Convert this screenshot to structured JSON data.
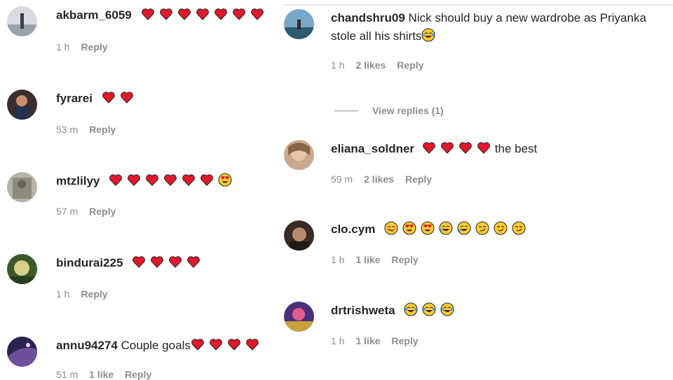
{
  "comments_left": [
    {
      "username": "akbarm_6059",
      "text": "",
      "emojis": [
        "heart",
        "heart",
        "heart",
        "heart",
        "heart",
        "heart",
        "heart"
      ],
      "time": "1 h",
      "likes": "",
      "reply": "Reply"
    },
    {
      "username": "fyrarei",
      "text": "",
      "emojis": [
        "heart",
        "heart"
      ],
      "time": "53 m",
      "likes": "",
      "reply": "Reply"
    },
    {
      "username": "mtzlilyy",
      "text": "",
      "emojis": [
        "heart",
        "heart",
        "heart",
        "heart",
        "heart",
        "heart",
        "heart-eyes"
      ],
      "time": "57 m",
      "likes": "",
      "reply": "Reply"
    },
    {
      "username": "bindurai225",
      "text": "",
      "emojis": [
        "heart",
        "heart",
        "heart",
        "heart"
      ],
      "time": "1 h",
      "likes": "",
      "reply": "Reply"
    },
    {
      "username": "annu94274",
      "text": "Couple goals",
      "emojis": [
        "heart",
        "heart",
        "heart",
        "heart"
      ],
      "time": "51 m",
      "likes": "1 like",
      "reply": "Reply"
    }
  ],
  "comments_right": [
    {
      "username": "chandshru09",
      "text": "Nick should buy a new wardrobe as Priyanka stole all his shirts",
      "emojis": [
        "tears-of-joy"
      ],
      "time": "1 h",
      "likes": "2 likes",
      "reply": "Reply"
    },
    {
      "username": "eliana_soldner",
      "text": "the best",
      "emojis": [
        "heart",
        "heart",
        "heart",
        "heart"
      ],
      "time": "59 m",
      "likes": "2 likes",
      "reply": "Reply"
    },
    {
      "username": "clo.cym",
      "text": "",
      "emojis": [
        "woozy",
        "heart-eyes",
        "heart-eyes",
        "rofl",
        "rofl",
        "smirk",
        "smirk",
        "smirk"
      ],
      "time": "1 h",
      "likes": "1 like",
      "reply": "Reply"
    },
    {
      "username": "drtrishweta",
      "text": "",
      "emojis": [
        "tears-of-joy",
        "tears-of-joy",
        "tears-of-joy"
      ],
      "time": "1 h",
      "likes": "1 like",
      "reply": "Reply"
    }
  ],
  "view_replies": "View replies (1)",
  "colors": {
    "text": "#262626",
    "meta": "#8e8e8e",
    "heart": "#e0192b",
    "emoji_face": "#ffcc33"
  }
}
